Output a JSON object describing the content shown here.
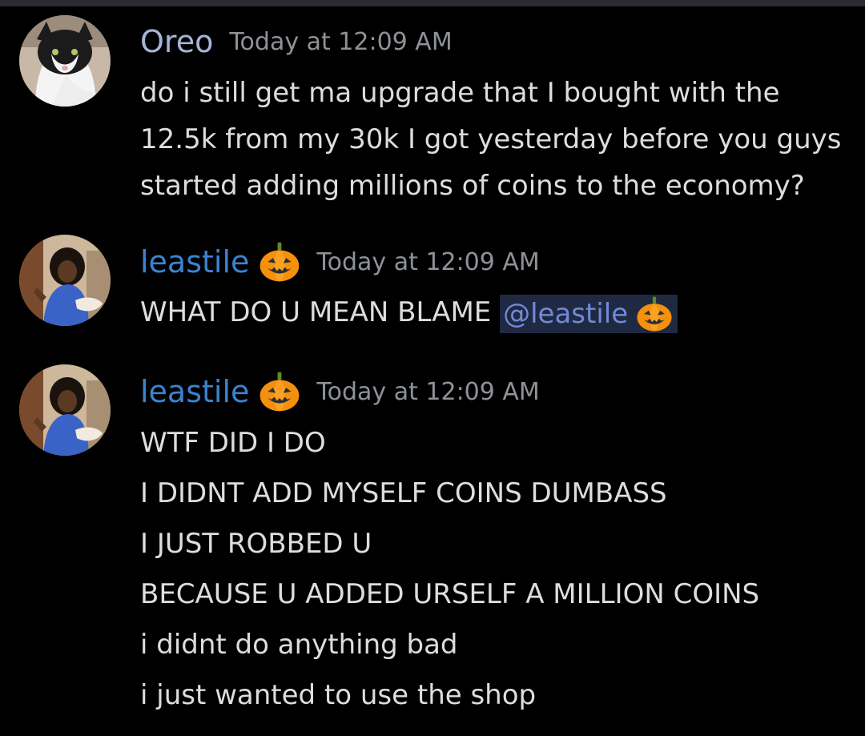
{
  "colors": {
    "background": "#000000",
    "oreo_name": "#a6b5d6",
    "leastile_name": "#3b83cf",
    "timestamp": "#8e9297",
    "text": "#dcddde",
    "mention_bg": "#1f2941",
    "mention_text": "#7289da"
  },
  "messages": [
    {
      "username": "Oreo",
      "username_emoji": "",
      "timestamp": "Today at 12:09 AM",
      "avatar": "cat-avatar",
      "lines": [
        "do i still get ma upgrade that I bought with the",
        "12.5k from my 30k I got yesterday before you guys",
        "started adding millions of coins to the economy?"
      ]
    },
    {
      "username": "leastile",
      "username_emoji": "jack-o-lantern-icon",
      "timestamp": "Today at 12:09 AM",
      "avatar": "person-avatar",
      "lines": [
        "WHAT DO U MEAN BLAME"
      ],
      "mention": "@leastile"
    },
    {
      "username": "leastile",
      "username_emoji": "jack-o-lantern-icon",
      "timestamp": "Today at 12:09 AM",
      "avatar": "person-avatar",
      "lines": [
        "WTF DID I DO",
        "I DIDNT ADD MYSELF COINS DUMBASS",
        "I JUST ROBBED U",
        "BECAUSE U ADDED URSELF A MILLION COINS",
        "i didnt do anything bad",
        "i just wanted to use the shop"
      ]
    }
  ]
}
